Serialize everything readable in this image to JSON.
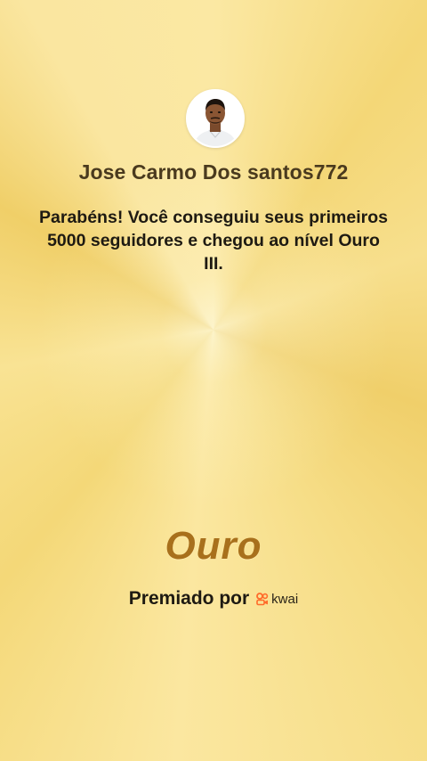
{
  "profile": {
    "username": "Jose Carmo Dos santos772",
    "avatar_alt": "avatar"
  },
  "achievement": {
    "message": "Parabéns! Você conseguiu seus primeiros 5000 seguidores e chegou ao nível Ouro III.",
    "level_title": "Ouro"
  },
  "footer": {
    "awarded_by_label": "Premiado por",
    "brand_name": "kwai",
    "brand_icon": "kwai-logo-icon"
  },
  "colors": {
    "gold_text": "#a8701c",
    "brand_orange": "#ff6a2a"
  }
}
